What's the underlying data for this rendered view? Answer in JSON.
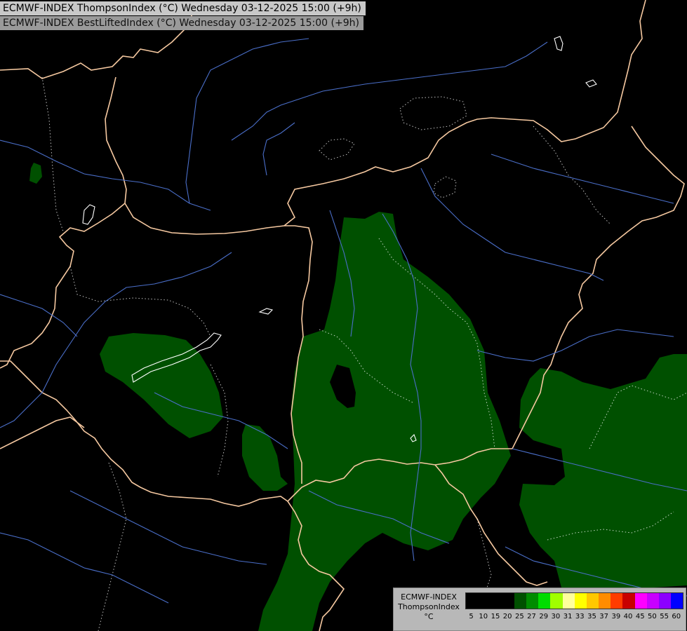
{
  "header": {
    "title_line1": "ECMWF-INDEX ThompsonIndex (°C) Wednesday 03-12-2025 15:00 (+9h)",
    "title_line2": "ECMWF-INDEX BestLiftedIndex (°C) Wednesday 03-12-2025 15:00 (+9h)"
  },
  "legend": {
    "model": "ECMWF-INDEX",
    "parameter": "ThompsonIndex",
    "unit": "°C",
    "ticks": [
      "5",
      "10",
      "15",
      "20",
      "25",
      "27",
      "29",
      "30",
      "31",
      "33",
      "35",
      "37",
      "39",
      "40",
      "45",
      "50",
      "55",
      "60"
    ],
    "colors": [
      "#000000",
      "#000000",
      "#000000",
      "#000000",
      "#005000",
      "#008c00",
      "#00dc00",
      "#a0ff00",
      "#ffff9c",
      "#ffff00",
      "#ffc800",
      "#ff8c00",
      "#ff3c00",
      "#c80000",
      "#ff00ff",
      "#c800ff",
      "#8c00ff",
      "#0000ff"
    ]
  },
  "map_colors": {
    "background": "#000000",
    "thompson_25": "#005000",
    "border": "#f5c8a0",
    "region_border": "#ffffff",
    "river": "#4a6ec8"
  }
}
